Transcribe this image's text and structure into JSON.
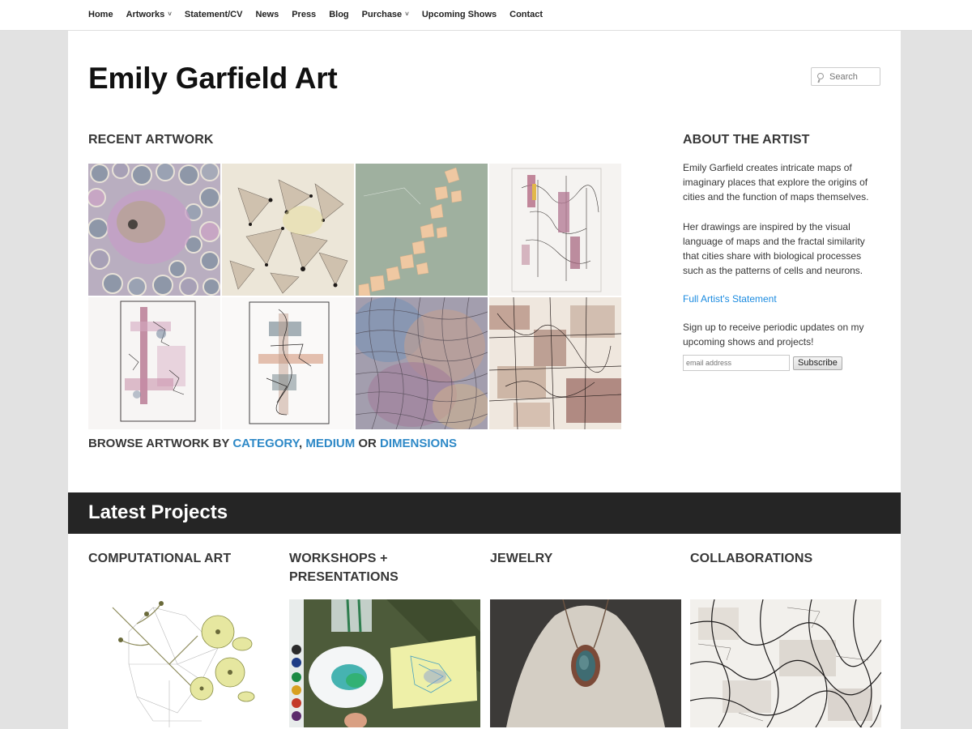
{
  "nav": {
    "items": [
      {
        "label": "Home",
        "dropdown": false
      },
      {
        "label": "Artworks",
        "dropdown": true
      },
      {
        "label": "Statement/CV",
        "dropdown": false
      },
      {
        "label": "News",
        "dropdown": false
      },
      {
        "label": "Press",
        "dropdown": false
      },
      {
        "label": "Blog",
        "dropdown": false
      },
      {
        "label": "Purchase",
        "dropdown": true
      },
      {
        "label": "Upcoming Shows",
        "dropdown": false
      },
      {
        "label": "Contact",
        "dropdown": false
      }
    ]
  },
  "header": {
    "site_title": "Emily Garfield Art",
    "search_placeholder": "Search"
  },
  "recent": {
    "heading": "RECENT ARTWORK",
    "browse_prefix": "BROWSE ARTWORK BY",
    "browse_category": "CATEGORY",
    "browse_comma": ",",
    "browse_medium": "MEDIUM",
    "browse_or": "OR",
    "browse_dimensions": "DIMENSIONS"
  },
  "sidebar": {
    "heading": "ABOUT THE ARTIST",
    "para1": "Emily Garfield creates intricate maps of imaginary places that explore the origins of cities and the function of maps themselves.",
    "para2": "Her drawings are inspired by the visual language of maps and the fractal similarity that cities share with biological processes such as the patterns of cells and neurons.",
    "link": "Full Artist's Statement",
    "signup": "Sign up to receive periodic updates on my upcoming shows and projects!",
    "email_placeholder": "email address",
    "subscribe_label": "Subscribe"
  },
  "projects": {
    "heading": "Latest Projects",
    "items": [
      {
        "title": "COMPUTATIONAL ART"
      },
      {
        "title": "WORKSHOPS + PRESENTATIONS"
      },
      {
        "title": "JEWELRY"
      },
      {
        "title": "COLLABORATIONS"
      }
    ]
  },
  "colors": {
    "link_blue": "#2e89c7",
    "band_dark": "#252525",
    "page_bg": "#e2e2e2"
  }
}
